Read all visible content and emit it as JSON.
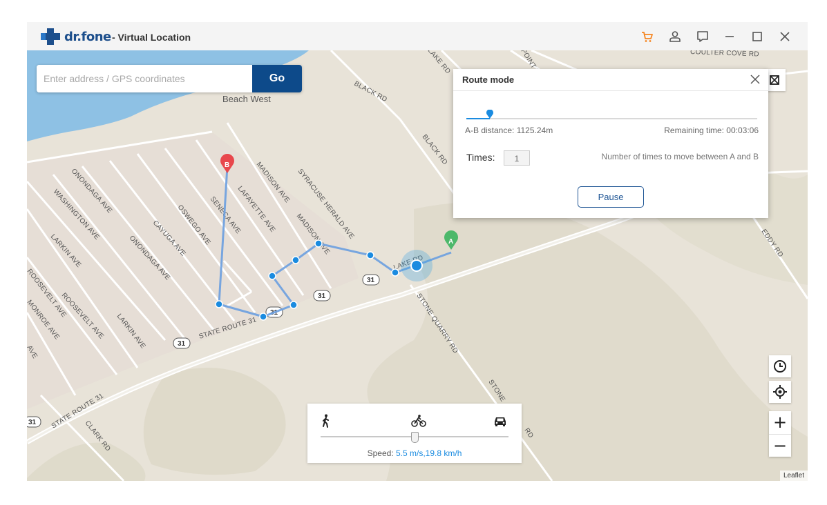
{
  "app": {
    "brand": "dr.fone",
    "subtitle": "- Virtual Location",
    "icons": [
      "cart-icon",
      "user-icon",
      "feedback-icon",
      "minimize-icon",
      "maximize-icon",
      "close-icon"
    ],
    "accent_color": "#f5841f",
    "brand_color": "#1d4f8c"
  },
  "search": {
    "placeholder": "Enter address / GPS coordinates",
    "value": "",
    "go_label": "Go"
  },
  "route_mode": {
    "title": "Route mode",
    "progress": 0.08,
    "distance_label": "A-B distance: 1125.24m",
    "remaining_label": "Remaining time: 00:03:06",
    "times_label": "Times:",
    "times_value": "1",
    "times_hint": "Number of times to move between A and B",
    "pause_label": "Pause",
    "progress_color": "#1a8be0"
  },
  "speed": {
    "prefix": "Speed: ",
    "value": "5.5 m/s,19.8 km/h",
    "modes": [
      "walk-icon",
      "bike-icon",
      "car-icon"
    ],
    "slider_position": 0.5
  },
  "map": {
    "place_label": "Beach West",
    "roads": [
      "BLACK RD",
      "ONONDAGA AVE",
      "WASHINGTON AVE",
      "LARKIN AVE",
      "CAYUGA AVE",
      "OSWEGO AVE",
      "SENECA AVE",
      "LAFAYETTE AVE",
      "MADISON AVE",
      "SYRACUSE HERALD AVE",
      "ROOSEVELT AVE",
      "MONROE AVE",
      "STATE ROUTE 31",
      "STONE QUARRY RD",
      "CLARK RD",
      "EDDY RD",
      "COULTER COVE RD",
      "LAKE RD"
    ],
    "shield": "31",
    "marker_a": "A",
    "marker_b": "B",
    "controls": [
      "history-icon",
      "locate-icon",
      "zoom-in",
      "zoom-out"
    ],
    "zoom_in_label": "+",
    "zoom_out_label": "−",
    "attribution": "Leaflet"
  }
}
